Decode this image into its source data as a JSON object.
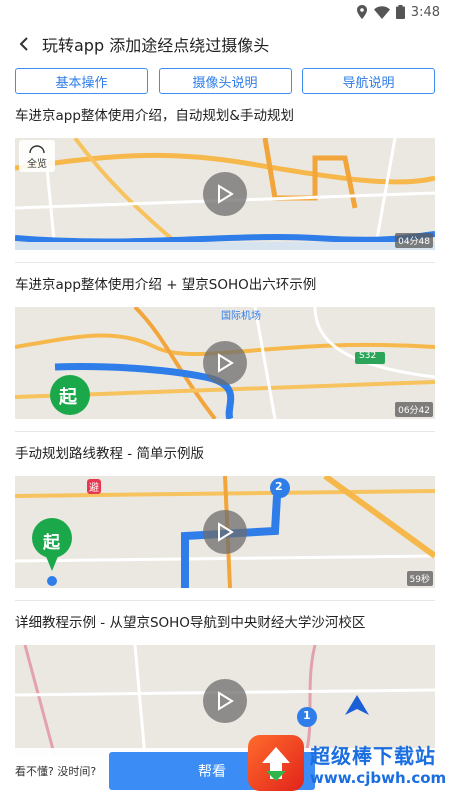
{
  "status": {
    "time": "3:48"
  },
  "header": {
    "title": "玩转app 添加途经点绕过摄像头"
  },
  "tabs": [
    {
      "label": "基本操作"
    },
    {
      "label": "摄像头说明"
    },
    {
      "label": "导航说明"
    }
  ],
  "videos": [
    {
      "title": "车进京app整体使用介绍，自动规划&手动规划",
      "duration": "04分48",
      "overview": "全览"
    },
    {
      "title": "车进京app整体使用介绍 + 望京SOHO出六环示例",
      "duration": "06分42",
      "map_label": "国际机场",
      "road": "S32",
      "origin": "起"
    },
    {
      "title": "手动规划路线教程 - 简单示例版",
      "duration": "59秒",
      "origin": "起",
      "waypoint": "2",
      "avoid": "避"
    },
    {
      "title": "详细教程示例 - 从望京SOHO导航到中央财经大学沙河校区",
      "duration": "",
      "waypoint": "1"
    }
  ],
  "bottom": {
    "hint": "看不懂? 没时间?",
    "help_label": "帮看"
  },
  "watermark": {
    "main": "超级棒下载站",
    "url": "www.cjbwh.com"
  },
  "colors": {
    "accent": "#3b8cf4",
    "route": "#2f7de8",
    "camera": "#e8384f",
    "origin": "#1aa84a"
  }
}
